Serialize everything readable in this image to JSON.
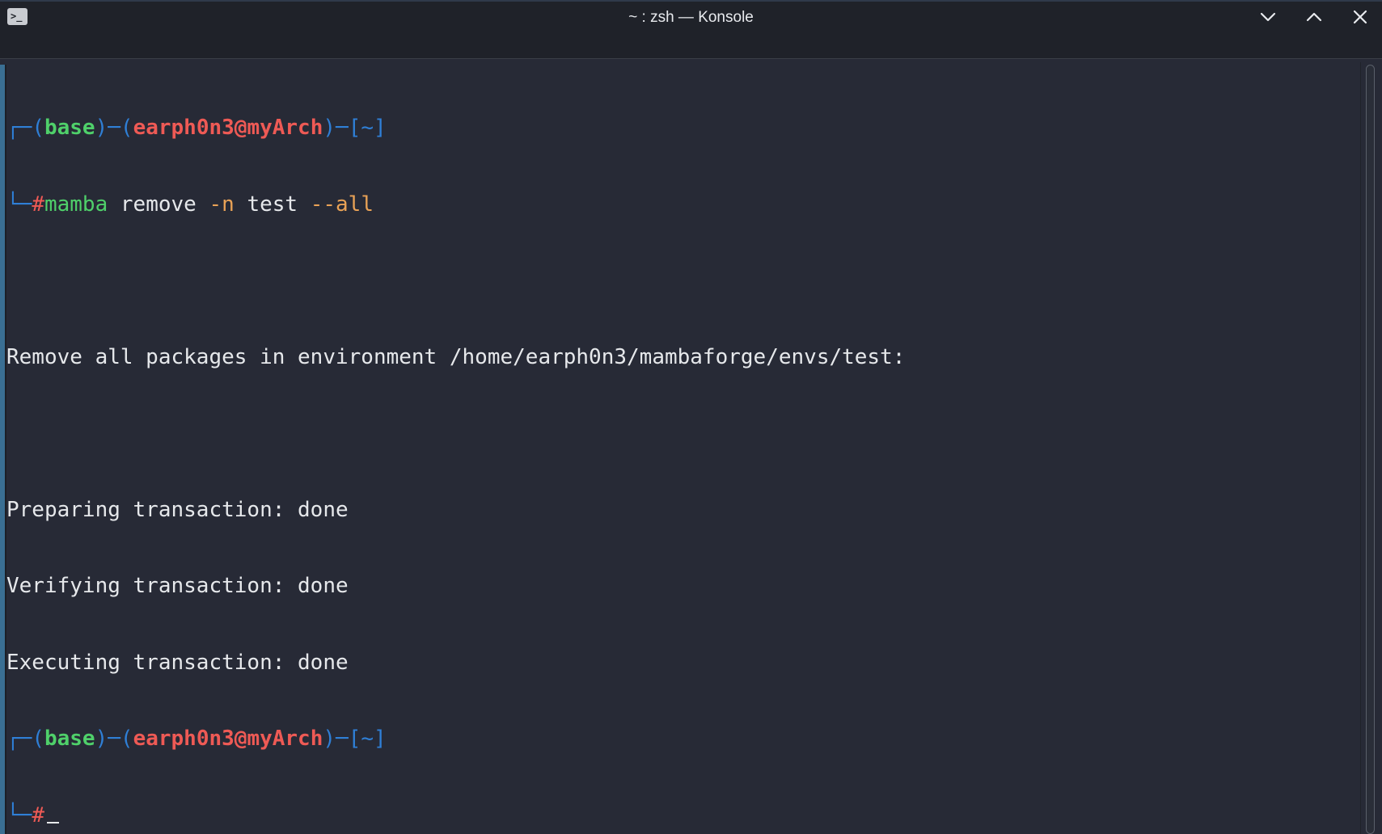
{
  "window": {
    "title": "~ : zsh — Konsole",
    "app_icon": "terminal-icon",
    "controls": [
      "chevron-down-icon",
      "chevron-up-icon",
      "close-icon"
    ]
  },
  "colors": {
    "background": "#272a36",
    "titlebar": "#1f2229",
    "prompt_bracket": "#2f7fd6",
    "env": "#4fd06a",
    "user_host": "#ee5a55",
    "option": "#e9a256",
    "text": "#e6e8eb"
  },
  "terminal": {
    "prompt1": {
      "corner": "┌─",
      "open_paren": "(",
      "env": "base",
      "close_paren": ")",
      "dash1": "─",
      "open_paren2": "(",
      "user_host": "earph0n3@myArch",
      "close_paren2": ")",
      "dash2": "─",
      "open_bracket": "[",
      "cwd": "~",
      "close_bracket": "]",
      "second_corner": "└─",
      "hash": "#",
      "command": "mamba",
      "arg1": " remove ",
      "opt1": "-n",
      "arg2": " test ",
      "opt2": "--all"
    },
    "output": [
      "",
      "Remove all packages in environment /home/earph0n3/mambaforge/envs/test:",
      "",
      "Preparing transaction: done",
      "Verifying transaction: done",
      "Executing transaction: done"
    ],
    "prompt2": {
      "corner": "┌─",
      "open_paren": "(",
      "env": "base",
      "close_paren": ")",
      "dash1": "─",
      "open_paren2": "(",
      "user_host": "earph0n3@myArch",
      "close_paren2": ")",
      "dash2": "─",
      "open_bracket": "[",
      "cwd": "~",
      "close_bracket": "]",
      "second_corner": "└─",
      "hash": "#"
    }
  }
}
